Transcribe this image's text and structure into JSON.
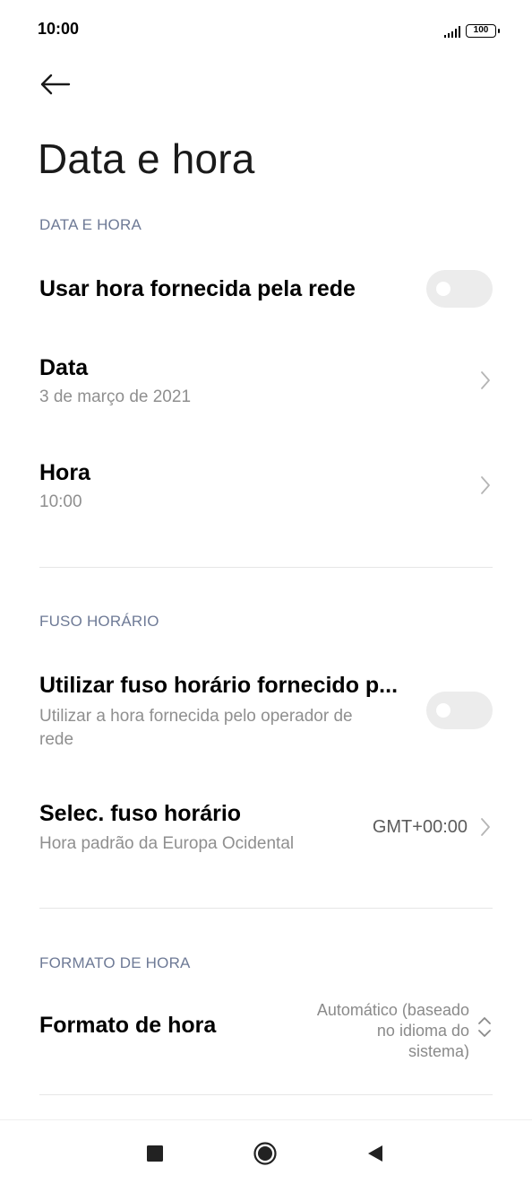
{
  "status_bar": {
    "time": "10:00",
    "battery": "100",
    "signal_icon": "signal-icon",
    "battery_icon": "battery-icon"
  },
  "header": {
    "back_icon": "back-arrow-icon",
    "title": "Data e hora"
  },
  "sections": {
    "date_time": {
      "header": "DATA E HORA",
      "network_time": {
        "title": "Usar hora fornecida pela rede",
        "enabled": false
      },
      "date": {
        "title": "Data",
        "value": "3 de março de 2021"
      },
      "time": {
        "title": "Hora",
        "value": "10:00"
      }
    },
    "time_zone": {
      "header": "FUSO HORÁRIO",
      "network_tz": {
        "title": "Utilizar fuso horário fornecido p...",
        "subtitle_line1": "Utilizar a hora fornecida pelo operador de",
        "subtitle_line2": "rede",
        "enabled": false
      },
      "select_tz": {
        "title": "Selec. fuso horário",
        "subtitle": "Hora padrão da Europa Ocidental",
        "value": "GMT+00:00"
      }
    },
    "time_format": {
      "header": "FORMATO DE HORA",
      "format": {
        "title": "Formato de hora",
        "value_line1": "Automático (baseado",
        "value_line2": "no idioma do",
        "value_line3": "sistema)"
      }
    }
  },
  "nav_bar": {
    "recents_icon": "square-icon",
    "home_icon": "circle-icon",
    "back_icon": "triangle-back-icon"
  },
  "colors": {
    "section_header": "#6e7a96",
    "toggle_off": "#ececec",
    "subtitle": "#8f8f8f"
  }
}
